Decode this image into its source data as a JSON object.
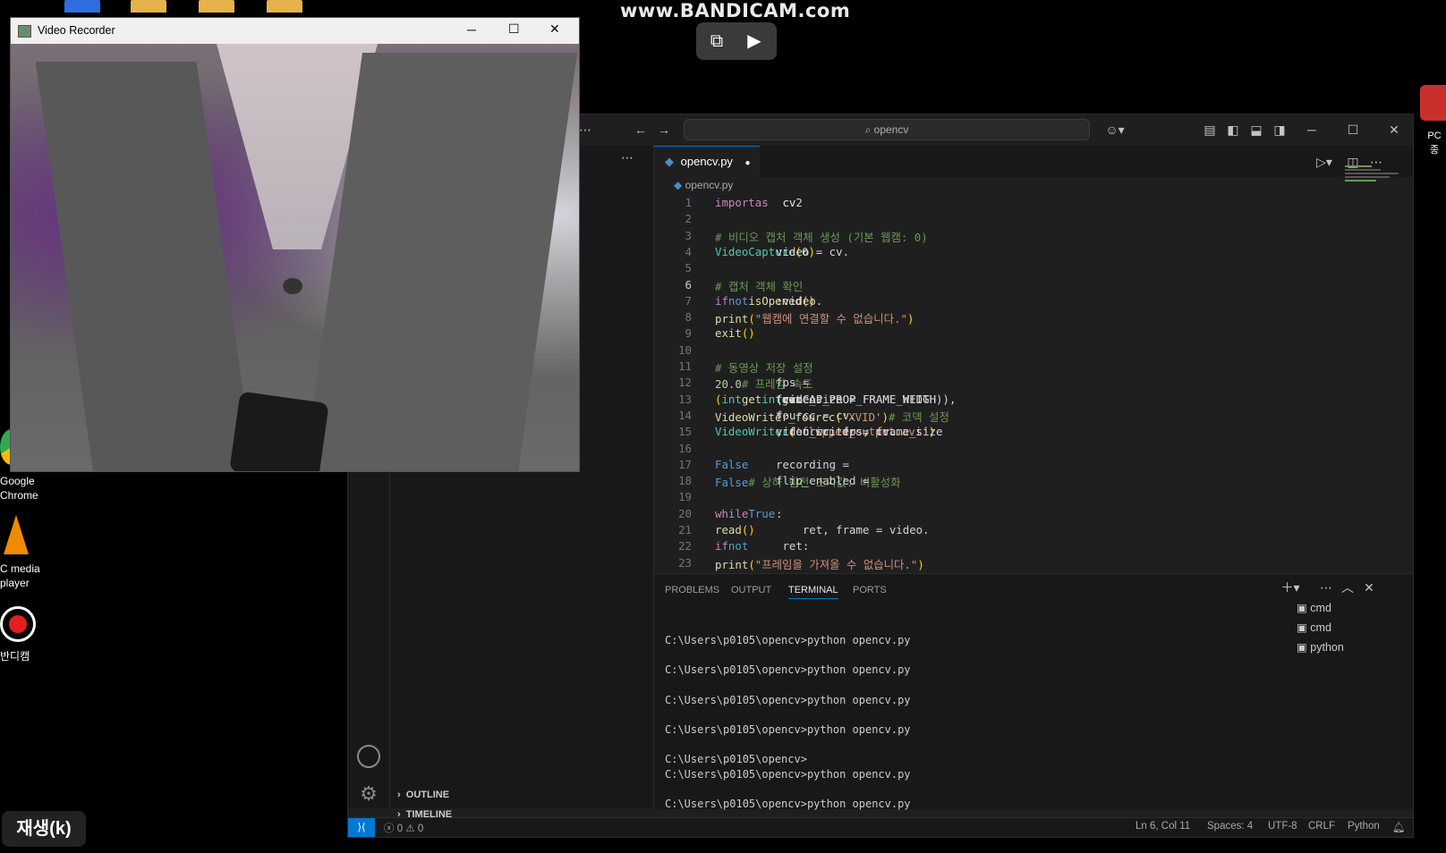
{
  "bandicam": {
    "watermark": "www.BANDICAM.com",
    "icons": [
      "screen-capture-icon",
      "video-star-icon"
    ]
  },
  "desktop": {
    "icons": [
      {
        "name": "google-chrome-icon",
        "label1": "Google",
        "label2": "Chrome"
      },
      {
        "name": "vlc-icon",
        "label1": "C media",
        "label2": "player"
      },
      {
        "name": "bandicam-icon",
        "label1": "반디캠",
        "label2": ""
      }
    ],
    "right_icon_label": "PC 종",
    "play_button": "재생(k)"
  },
  "video_recorder": {
    "title": "Video Recorder"
  },
  "vscode": {
    "search": "opencv",
    "tab": {
      "filename": "opencv.py",
      "modified_dot": "●"
    },
    "breadcrumb": "opencv.py",
    "code": [
      {
        "n": "1",
        "parts": [
          {
            "t": "import",
            "c": "kw2"
          },
          {
            "t": " cv2 ",
            "c": "cl"
          },
          {
            "t": "as",
            "c": "kw2"
          },
          {
            "t": " cv",
            "c": "cl"
          }
        ]
      },
      {
        "n": "2",
        "parts": []
      },
      {
        "n": "3",
        "parts": [
          {
            "t": "# 비디오 캡처 객체 생성 (기본 웹캠: 0)",
            "c": "cm"
          }
        ]
      },
      {
        "n": "4",
        "parts": [
          {
            "t": "video = cv.",
            "c": "cl"
          },
          {
            "t": "VideoCapture",
            "c": "ty"
          },
          {
            "t": "(",
            "c": "br"
          },
          {
            "t": "0",
            "c": "num"
          },
          {
            "t": ")",
            "c": "br"
          }
        ]
      },
      {
        "n": "5",
        "parts": []
      },
      {
        "n": "6",
        "parts": [
          {
            "t": "# 캡처 객체 확인",
            "c": "cm"
          }
        ]
      },
      {
        "n": "7",
        "parts": [
          {
            "t": "if",
            "c": "kw2"
          },
          {
            "t": " ",
            "c": "cl"
          },
          {
            "t": "not",
            "c": "kw"
          },
          {
            "t": " video.",
            "c": "cl"
          },
          {
            "t": "isOpened",
            "c": "fn"
          },
          {
            "t": "()",
            "c": "br"
          },
          {
            "t": ":",
            "c": "cl"
          }
        ]
      },
      {
        "n": "8",
        "parts": [
          {
            "t": "    ",
            "c": "cl"
          },
          {
            "t": "print",
            "c": "fn"
          },
          {
            "t": "(",
            "c": "br"
          },
          {
            "t": "\"웹캠에 연결할 수 없습니다.\"",
            "c": "str"
          },
          {
            "t": ")",
            "c": "br"
          }
        ]
      },
      {
        "n": "9",
        "parts": [
          {
            "t": "    ",
            "c": "cl"
          },
          {
            "t": "exit",
            "c": "fn"
          },
          {
            "t": "()",
            "c": "br"
          }
        ]
      },
      {
        "n": "10",
        "parts": []
      },
      {
        "n": "11",
        "parts": [
          {
            "t": "# 동영상 저장 설정",
            "c": "cm"
          }
        ]
      },
      {
        "n": "12",
        "parts": [
          {
            "t": "fps = ",
            "c": "cl"
          },
          {
            "t": "20.0",
            "c": "num"
          },
          {
            "t": "  ",
            "c": "cl"
          },
          {
            "t": "# 프레임 속도",
            "c": "cm"
          }
        ]
      },
      {
        "n": "13",
        "parts": [
          {
            "t": "frame_size = ",
            "c": "cl"
          },
          {
            "t": "(",
            "c": "br"
          },
          {
            "t": "int",
            "c": "ty"
          },
          {
            "t": "(video.",
            "c": "cl"
          },
          {
            "t": "get",
            "c": "fn"
          },
          {
            "t": "(cv.CAP_PROP_FRAME_WIDTH)), ",
            "c": "cl"
          },
          {
            "t": "int",
            "c": "ty"
          },
          {
            "t": "(video.",
            "c": "cl"
          },
          {
            "t": "get",
            "c": "fn"
          },
          {
            "t": "(cv.CAP_PROP_FRAME_HEIGH",
            "c": "cl"
          }
        ]
      },
      {
        "n": "14",
        "parts": [
          {
            "t": "fourcc = cv.",
            "c": "cl"
          },
          {
            "t": "VideoWriter_fourcc",
            "c": "fn"
          },
          {
            "t": "(",
            "c": "br"
          },
          {
            "t": "*",
            "c": "cl"
          },
          {
            "t": "'XVID'",
            "c": "str"
          },
          {
            "t": ")",
            "c": "br"
          },
          {
            "t": "  ",
            "c": "cl"
          },
          {
            "t": "# 코덱 설정",
            "c": "cm"
          }
        ]
      },
      {
        "n": "15",
        "parts": [
          {
            "t": "video_writer = cv.",
            "c": "cl"
          },
          {
            "t": "VideoWriter",
            "c": "ty"
          },
          {
            "t": "(",
            "c": "br"
          },
          {
            "t": "'flipped_output.avi'",
            "c": "str"
          },
          {
            "t": ", fourcc, fps, frame_size",
            "c": "cl"
          },
          {
            "t": ")",
            "c": "br"
          }
        ]
      },
      {
        "n": "16",
        "parts": []
      },
      {
        "n": "17",
        "parts": [
          {
            "t": "recording = ",
            "c": "cl"
          },
          {
            "t": "False",
            "c": "kw"
          }
        ]
      },
      {
        "n": "18",
        "parts": [
          {
            "t": "flip_enabled = ",
            "c": "cl"
          },
          {
            "t": "False",
            "c": "kw"
          },
          {
            "t": "  ",
            "c": "cl"
          },
          {
            "t": "# 상하 반전 초기값: 비활성화",
            "c": "cm"
          }
        ]
      },
      {
        "n": "19",
        "parts": []
      },
      {
        "n": "20",
        "parts": [
          {
            "t": "while",
            "c": "kw2"
          },
          {
            "t": " ",
            "c": "cl"
          },
          {
            "t": "True",
            "c": "kw"
          },
          {
            "t": ":",
            "c": "cl"
          }
        ]
      },
      {
        "n": "21",
        "parts": [
          {
            "t": "    ret, frame = video.",
            "c": "cl"
          },
          {
            "t": "read",
            "c": "fn"
          },
          {
            "t": "()",
            "c": "br"
          }
        ]
      },
      {
        "n": "22",
        "parts": [
          {
            "t": "    ",
            "c": "cl"
          },
          {
            "t": "if",
            "c": "kw2"
          },
          {
            "t": " ",
            "c": "cl"
          },
          {
            "t": "not",
            "c": "kw"
          },
          {
            "t": " ret:",
            "c": "cl"
          }
        ]
      },
      {
        "n": "23",
        "parts": [
          {
            "t": "        ",
            "c": "cl"
          },
          {
            "t": "print",
            "c": "fn"
          },
          {
            "t": "(",
            "c": "br"
          },
          {
            "t": "\"프레임을 가져올 수 없습니다.\"",
            "c": "str"
          },
          {
            "t": ")",
            "c": "br"
          }
        ]
      }
    ],
    "sidebar": {
      "outline": "OUTLINE",
      "timeline": "TIMELINE"
    },
    "panel": {
      "tabs": [
        "PROBLEMS",
        "OUTPUT",
        "TERMINAL",
        "PORTS"
      ],
      "terminal_lines": [
        "",
        "C:\\Users\\p0105\\opencv>python opencv.py",
        "",
        "C:\\Users\\p0105\\opencv>python opencv.py",
        "",
        "C:\\Users\\p0105\\opencv>python opencv.py",
        "",
        "C:\\Users\\p0105\\opencv>python opencv.py",
        "",
        "C:\\Users\\p0105\\opencv>",
        "C:\\Users\\p0105\\opencv>python opencv.py",
        "",
        "C:\\Users\\p0105\\opencv>python opencv.py"
      ],
      "terminals": [
        "cmd",
        "cmd",
        "python"
      ]
    },
    "status": {
      "errors": "0",
      "warnings": "0",
      "cursor": "Ln 6, Col 11",
      "spaces": "Spaces: 4",
      "encoding": "UTF-8",
      "eol": "CRLF",
      "language": "Python"
    }
  }
}
